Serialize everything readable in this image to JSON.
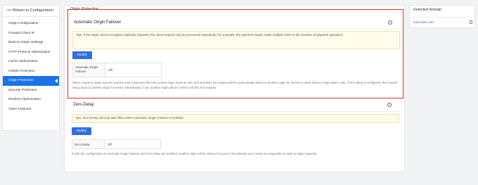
{
  "sidebar": {
    "back_label": "<< Return to Configuration",
    "items": [
      {
        "label": "Origin Configuration"
      },
      {
        "label": "Forward Client IP"
      },
      {
        "label": "Back-to-Origin Settings"
      },
      {
        "label": "HTTP Protocol Optimization"
      },
      {
        "label": "Cache Optimization"
      },
      {
        "label": "Hotlink Protection"
      },
      {
        "label": "Origin Protection"
      },
      {
        "label": "Security Protection"
      },
      {
        "label": "Redirect Optimization"
      },
      {
        "label": "Video Features"
      }
    ],
    "active_index": 6
  },
  "main": {
    "title": "Origin Protection",
    "failover": {
      "title": "Automatic Origin Failover",
      "tip": "Tips: If the origin cannot recognize duplicate requests, the same request may be processed repeatedly. For example, the payment maybe made multiple times in the scenario of payment operation.",
      "modify_label": "Modify",
      "key": "Automatic Origin Failover",
      "value": "Off",
      "description": "When a back-to-origin request receives error responses from the current origin (such as 403, 404 and 503), the request will be automatically switch to another origin for service to lower back-to-origin failure ratio. If zero-delay is configured, the request will go back to another origin for service immediately; if not, another origin will be chosen until the next request."
    },
    "zero_delay": {
      "title": "Zero-Delay",
      "tip": "Tips: Zero-Delay will only take effect when Automatic Origin Failover is enabled.",
      "modify_label": "Modify",
      "key": "Zero-Delay",
      "value": "Off",
      "description": "If both the configuration of Automatic Origin Failover and Zero-Delay are enabled, another origin will be chosen for service immediately once errors are responded to back-to-origin requests."
    }
  },
  "right_panel": {
    "title": "Selected domain",
    "domain": "vod.1231.com"
  },
  "help_glyph": "?"
}
